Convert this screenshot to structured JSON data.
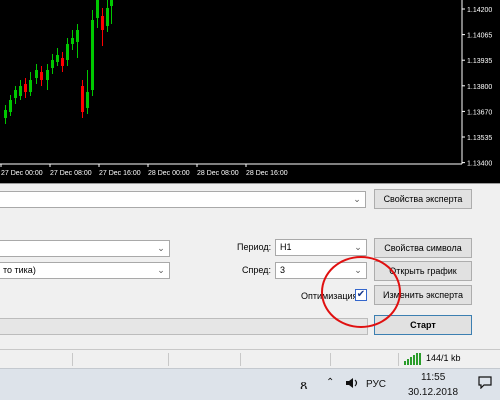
{
  "chart": {
    "y_labels": [
      "1.14200",
      "1.14065",
      "1.13935",
      "1.13800",
      "1.13670",
      "1.13535",
      "1.13400"
    ],
    "x_labels": [
      "27 Dec 00:00",
      "27 Dec 08:00",
      "27 Dec 16:00",
      "28 Dec 00:00",
      "28 Dec 08:00",
      "28 Dec 16:00"
    ],
    "bull_color": "#00c800",
    "bear_color": "#ff0000",
    "background": "#000000"
  },
  "tester": {
    "symbol_value": "",
    "model_value": "то тика)",
    "period_label": "Период:",
    "period_value": "H1",
    "spread_label": "Спред:",
    "spread_value": "3",
    "optimization_label": "Оптимизация",
    "optimization_checked": "✔",
    "expert_properties_button": "Свойства эксперта",
    "symbol_properties_button": "Свойства символа",
    "open_chart_button": "Открыть график",
    "modify_expert_button": "Изменить эксперта",
    "start_button": "Старт",
    "progress": 0
  },
  "statusbar": {
    "traffic": "144/1 kb"
  },
  "taskbar": {
    "language": "РУС",
    "time": "11:55",
    "date": "30.12.2018"
  }
}
